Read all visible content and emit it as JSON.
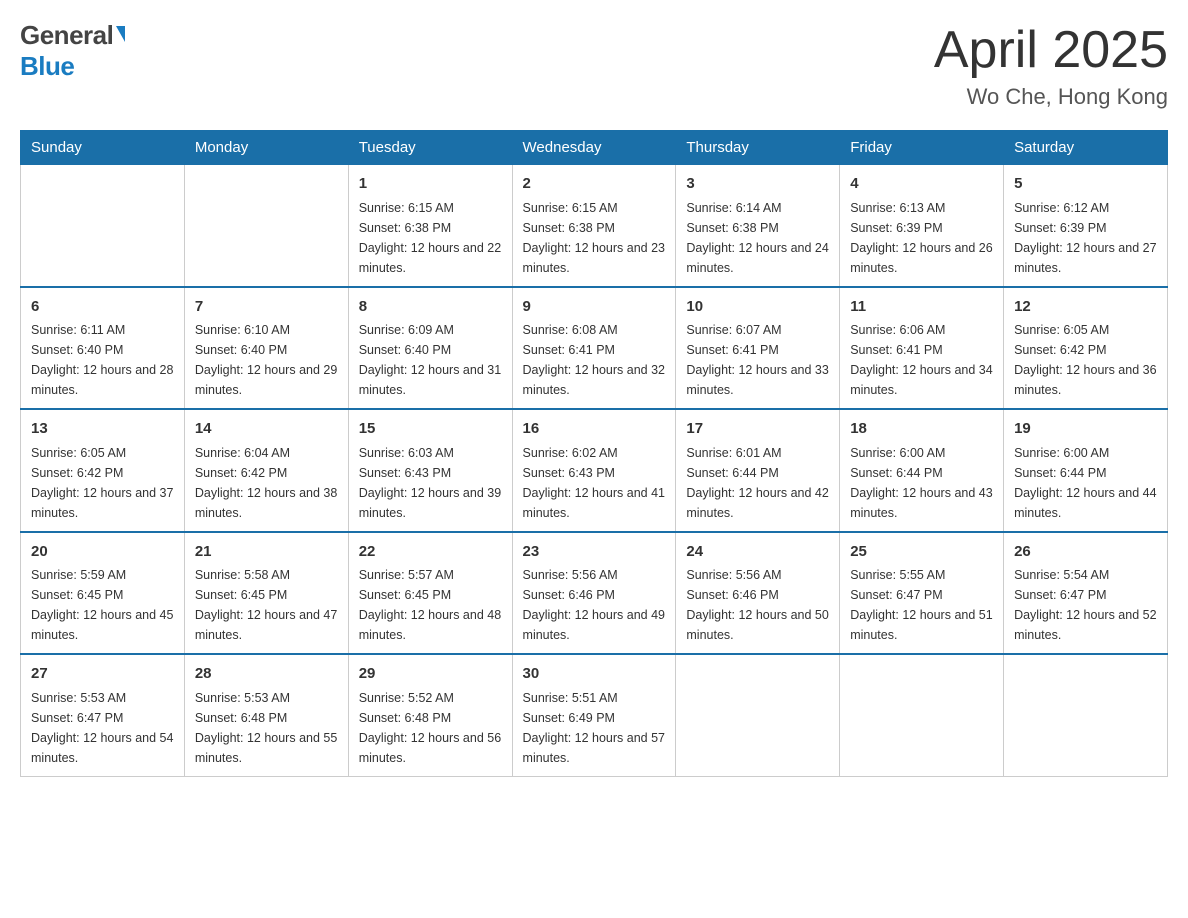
{
  "header": {
    "logo_general": "General",
    "logo_blue": "Blue",
    "month_title": "April 2025",
    "location": "Wo Che, Hong Kong"
  },
  "weekdays": [
    "Sunday",
    "Monday",
    "Tuesday",
    "Wednesday",
    "Thursday",
    "Friday",
    "Saturday"
  ],
  "weeks": [
    [
      {
        "day": "",
        "sunrise": "",
        "sunset": "",
        "daylight": ""
      },
      {
        "day": "",
        "sunrise": "",
        "sunset": "",
        "daylight": ""
      },
      {
        "day": "1",
        "sunrise": "Sunrise: 6:15 AM",
        "sunset": "Sunset: 6:38 PM",
        "daylight": "Daylight: 12 hours and 22 minutes."
      },
      {
        "day": "2",
        "sunrise": "Sunrise: 6:15 AM",
        "sunset": "Sunset: 6:38 PM",
        "daylight": "Daylight: 12 hours and 23 minutes."
      },
      {
        "day": "3",
        "sunrise": "Sunrise: 6:14 AM",
        "sunset": "Sunset: 6:38 PM",
        "daylight": "Daylight: 12 hours and 24 minutes."
      },
      {
        "day": "4",
        "sunrise": "Sunrise: 6:13 AM",
        "sunset": "Sunset: 6:39 PM",
        "daylight": "Daylight: 12 hours and 26 minutes."
      },
      {
        "day": "5",
        "sunrise": "Sunrise: 6:12 AM",
        "sunset": "Sunset: 6:39 PM",
        "daylight": "Daylight: 12 hours and 27 minutes."
      }
    ],
    [
      {
        "day": "6",
        "sunrise": "Sunrise: 6:11 AM",
        "sunset": "Sunset: 6:40 PM",
        "daylight": "Daylight: 12 hours and 28 minutes."
      },
      {
        "day": "7",
        "sunrise": "Sunrise: 6:10 AM",
        "sunset": "Sunset: 6:40 PM",
        "daylight": "Daylight: 12 hours and 29 minutes."
      },
      {
        "day": "8",
        "sunrise": "Sunrise: 6:09 AM",
        "sunset": "Sunset: 6:40 PM",
        "daylight": "Daylight: 12 hours and 31 minutes."
      },
      {
        "day": "9",
        "sunrise": "Sunrise: 6:08 AM",
        "sunset": "Sunset: 6:41 PM",
        "daylight": "Daylight: 12 hours and 32 minutes."
      },
      {
        "day": "10",
        "sunrise": "Sunrise: 6:07 AM",
        "sunset": "Sunset: 6:41 PM",
        "daylight": "Daylight: 12 hours and 33 minutes."
      },
      {
        "day": "11",
        "sunrise": "Sunrise: 6:06 AM",
        "sunset": "Sunset: 6:41 PM",
        "daylight": "Daylight: 12 hours and 34 minutes."
      },
      {
        "day": "12",
        "sunrise": "Sunrise: 6:05 AM",
        "sunset": "Sunset: 6:42 PM",
        "daylight": "Daylight: 12 hours and 36 minutes."
      }
    ],
    [
      {
        "day": "13",
        "sunrise": "Sunrise: 6:05 AM",
        "sunset": "Sunset: 6:42 PM",
        "daylight": "Daylight: 12 hours and 37 minutes."
      },
      {
        "day": "14",
        "sunrise": "Sunrise: 6:04 AM",
        "sunset": "Sunset: 6:42 PM",
        "daylight": "Daylight: 12 hours and 38 minutes."
      },
      {
        "day": "15",
        "sunrise": "Sunrise: 6:03 AM",
        "sunset": "Sunset: 6:43 PM",
        "daylight": "Daylight: 12 hours and 39 minutes."
      },
      {
        "day": "16",
        "sunrise": "Sunrise: 6:02 AM",
        "sunset": "Sunset: 6:43 PM",
        "daylight": "Daylight: 12 hours and 41 minutes."
      },
      {
        "day": "17",
        "sunrise": "Sunrise: 6:01 AM",
        "sunset": "Sunset: 6:44 PM",
        "daylight": "Daylight: 12 hours and 42 minutes."
      },
      {
        "day": "18",
        "sunrise": "Sunrise: 6:00 AM",
        "sunset": "Sunset: 6:44 PM",
        "daylight": "Daylight: 12 hours and 43 minutes."
      },
      {
        "day": "19",
        "sunrise": "Sunrise: 6:00 AM",
        "sunset": "Sunset: 6:44 PM",
        "daylight": "Daylight: 12 hours and 44 minutes."
      }
    ],
    [
      {
        "day": "20",
        "sunrise": "Sunrise: 5:59 AM",
        "sunset": "Sunset: 6:45 PM",
        "daylight": "Daylight: 12 hours and 45 minutes."
      },
      {
        "day": "21",
        "sunrise": "Sunrise: 5:58 AM",
        "sunset": "Sunset: 6:45 PM",
        "daylight": "Daylight: 12 hours and 47 minutes."
      },
      {
        "day": "22",
        "sunrise": "Sunrise: 5:57 AM",
        "sunset": "Sunset: 6:45 PM",
        "daylight": "Daylight: 12 hours and 48 minutes."
      },
      {
        "day": "23",
        "sunrise": "Sunrise: 5:56 AM",
        "sunset": "Sunset: 6:46 PM",
        "daylight": "Daylight: 12 hours and 49 minutes."
      },
      {
        "day": "24",
        "sunrise": "Sunrise: 5:56 AM",
        "sunset": "Sunset: 6:46 PM",
        "daylight": "Daylight: 12 hours and 50 minutes."
      },
      {
        "day": "25",
        "sunrise": "Sunrise: 5:55 AM",
        "sunset": "Sunset: 6:47 PM",
        "daylight": "Daylight: 12 hours and 51 minutes."
      },
      {
        "day": "26",
        "sunrise": "Sunrise: 5:54 AM",
        "sunset": "Sunset: 6:47 PM",
        "daylight": "Daylight: 12 hours and 52 minutes."
      }
    ],
    [
      {
        "day": "27",
        "sunrise": "Sunrise: 5:53 AM",
        "sunset": "Sunset: 6:47 PM",
        "daylight": "Daylight: 12 hours and 54 minutes."
      },
      {
        "day": "28",
        "sunrise": "Sunrise: 5:53 AM",
        "sunset": "Sunset: 6:48 PM",
        "daylight": "Daylight: 12 hours and 55 minutes."
      },
      {
        "day": "29",
        "sunrise": "Sunrise: 5:52 AM",
        "sunset": "Sunset: 6:48 PM",
        "daylight": "Daylight: 12 hours and 56 minutes."
      },
      {
        "day": "30",
        "sunrise": "Sunrise: 5:51 AM",
        "sunset": "Sunset: 6:49 PM",
        "daylight": "Daylight: 12 hours and 57 minutes."
      },
      {
        "day": "",
        "sunrise": "",
        "sunset": "",
        "daylight": ""
      },
      {
        "day": "",
        "sunrise": "",
        "sunset": "",
        "daylight": ""
      },
      {
        "day": "",
        "sunrise": "",
        "sunset": "",
        "daylight": ""
      }
    ]
  ]
}
